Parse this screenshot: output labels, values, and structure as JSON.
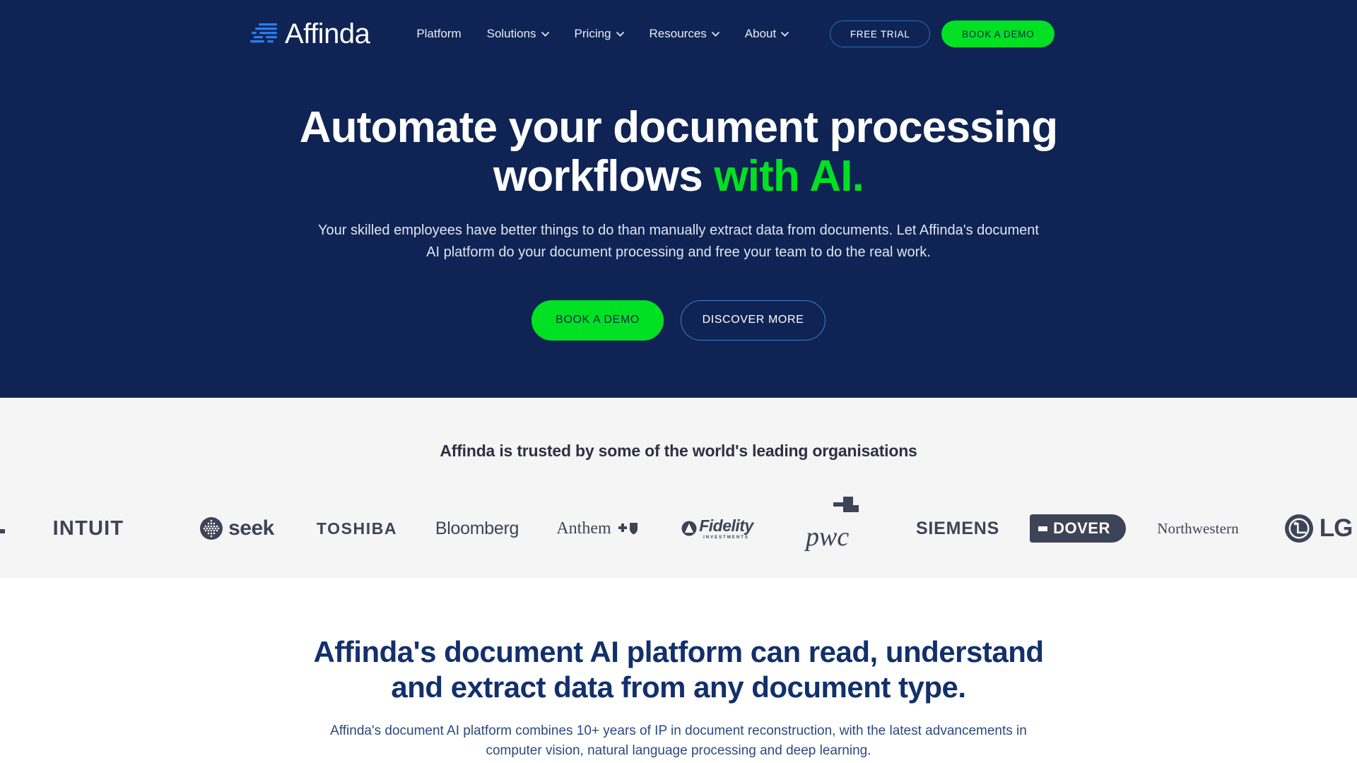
{
  "brand": {
    "name": "Affinda",
    "logo_icon": "affinda-bars-logo",
    "colors": {
      "navy": "#0f2454",
      "green": "#00e123",
      "light_gray": "#f5f5f6",
      "heading_blue": "#12306b",
      "logo_gray": "#3e4457"
    }
  },
  "nav": {
    "links": [
      {
        "label": "Platform",
        "has_dropdown": false
      },
      {
        "label": "Solutions",
        "has_dropdown": true
      },
      {
        "label": "Pricing",
        "has_dropdown": true
      },
      {
        "label": "Resources",
        "has_dropdown": true
      },
      {
        "label": "About",
        "has_dropdown": true
      }
    ],
    "free_trial_label": "FREE TRIAL",
    "book_demo_label": "BOOK A DEMO"
  },
  "hero": {
    "title_line1": "Automate your document processing",
    "title_line2_plain": "workflows ",
    "title_line2_accent": "with AI.",
    "subtitle": "Your skilled employees have better things to do than manually extract data from documents. Let Affinda's document AI platform do your document processing and free your team to do the real work.",
    "primary_cta": "BOOK A DEMO",
    "secondary_cta": "DISCOVER MORE"
  },
  "trusted": {
    "title": "Affinda is trusted by some of the world's leading organisations",
    "logos": [
      {
        "name": "intuit",
        "label": "INTUIT",
        "icon": ""
      },
      {
        "name": "seek",
        "label": "seek",
        "icon": "seek-sphere-icon"
      },
      {
        "name": "toshiba",
        "label": "TOSHIBA",
        "icon": ""
      },
      {
        "name": "bloomberg",
        "label": "Bloomberg",
        "icon": ""
      },
      {
        "name": "anthem",
        "label": "Anthem",
        "icon": "anthem-cross-shield-icon"
      },
      {
        "name": "fidelity",
        "label": "Fidelity",
        "sub": "INVESTMENTS",
        "icon": "fidelity-pyramid-icon"
      },
      {
        "name": "pwc",
        "label": "pwc",
        "icon": "pwc-blocks-icon"
      },
      {
        "name": "siemens",
        "label": "SIEMENS",
        "icon": ""
      },
      {
        "name": "dover",
        "label": "DOVER",
        "icon": "dover-dash-icon"
      },
      {
        "name": "northwestern",
        "label": "Northwestern",
        "icon": ""
      },
      {
        "name": "lg",
        "label": "LG",
        "icon": "lg-face-circle-icon"
      }
    ]
  },
  "platform_section": {
    "title_line1": "Affinda's document AI platform can read, understand",
    "title_line2": "and extract data from any document type.",
    "subtitle": "Affinda's document AI platform combines 10+ years of IP in document reconstruction, with the latest advancements in computer vision, natural language processing and deep learning."
  }
}
